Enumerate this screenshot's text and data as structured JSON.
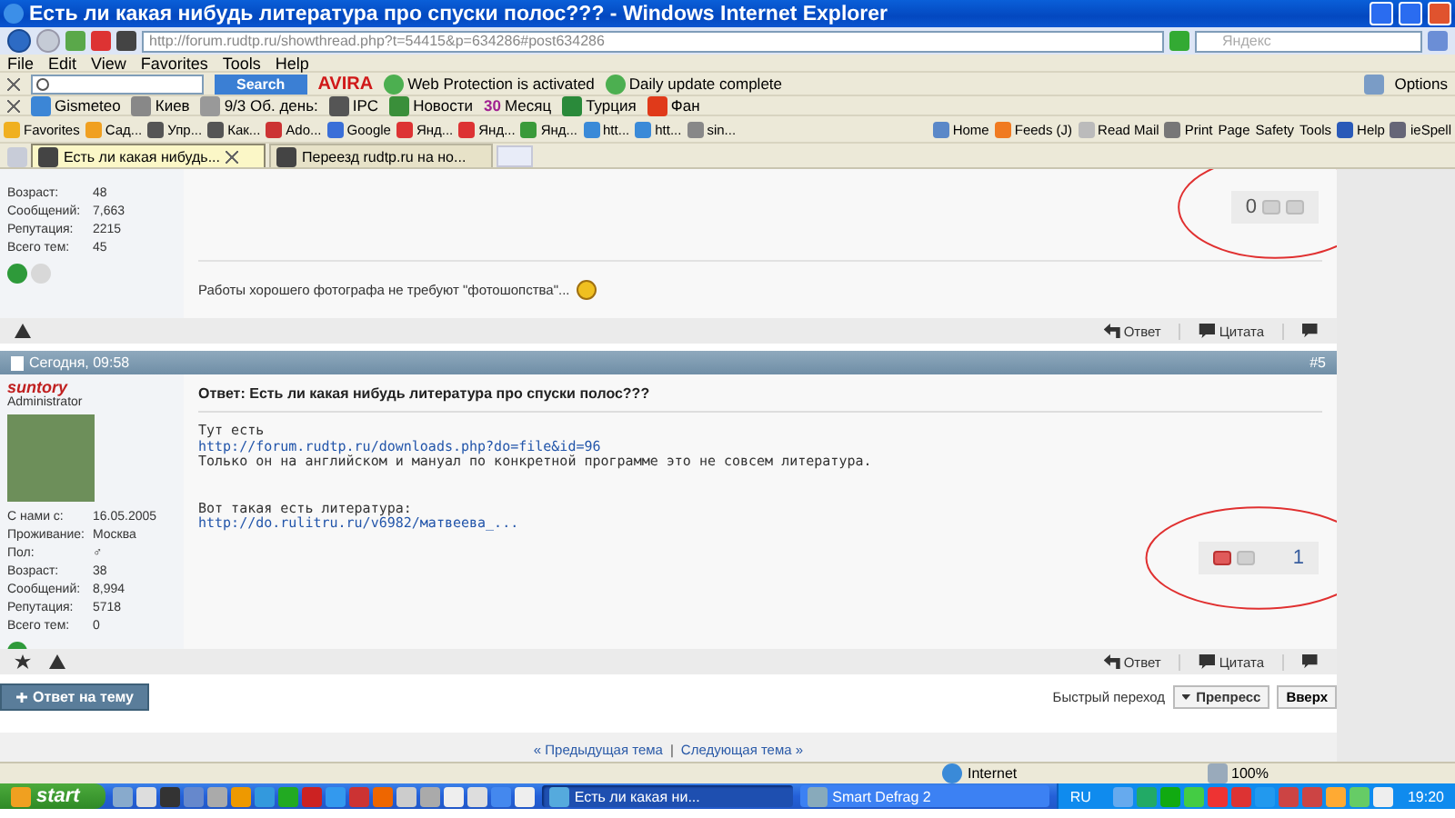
{
  "window": {
    "title": "Есть ли какая нибудь литература про спуски полос??? - Windows Internet Explorer"
  },
  "address_bar": {
    "url": "http://forum.rudtp.ru/showthread.php?t=54415&p=634286#post634286",
    "search_placeholder": "Яндекс"
  },
  "menu": [
    "File",
    "Edit",
    "View",
    "Favorites",
    "Tools",
    "Help"
  ],
  "avira_toolbar": {
    "search_button": "Search",
    "brand": "AVIRA",
    "statuses": [
      "Web Protection is activated",
      "Daily update complete"
    ],
    "options": "Options"
  },
  "weather_toolbar": {
    "items": [
      {
        "label": "Gismeteo"
      },
      {
        "label": "Киев"
      },
      {
        "label": "9/3 Об. день:"
      },
      {
        "label": "IPC"
      },
      {
        "label": "Новости"
      },
      {
        "badge": "30",
        "label": "Месяц"
      },
      {
        "label": "Турция"
      },
      {
        "label": "Фан"
      }
    ]
  },
  "favorites_bar": {
    "label": "Favorites",
    "links": [
      "Сад...",
      "Упр...",
      "Как...",
      "Ado...",
      "Google",
      "Янд...",
      "Янд...",
      "Янд...",
      "htt...",
      "htt...",
      "sin..."
    ],
    "commands": [
      "Home",
      "Feeds (J)",
      "Read Mail",
      "Print",
      "Page",
      "Safety",
      "Tools",
      "Help",
      "ieSpell"
    ]
  },
  "tabs": [
    {
      "label": "Есть ли какая нибудь...",
      "selected": true
    },
    {
      "label": "Переезд rudtp.ru на но...",
      "selected": false
    }
  ],
  "previous_post": {
    "stats": [
      {
        "label": "Возраст:",
        "value": "48"
      },
      {
        "label": "Сообщений:",
        "value": "7,663"
      },
      {
        "label": "Репутация:",
        "value": "2215"
      },
      {
        "label": "Всего тем:",
        "value": "45"
      }
    ],
    "votes": {
      "score": "0",
      "voted_down": false,
      "circled": true
    },
    "signature": "Работы хорошего фотографа не требуют \"фотошопства\"...",
    "actions": [
      "Ответ",
      "Цитата"
    ]
  },
  "post": {
    "date": "Сегодня, 09:58",
    "number": "#5",
    "username": "suntory",
    "rank": "Administrator",
    "stats": [
      {
        "label": "С нами с:",
        "value": "16.05.2005"
      },
      {
        "label": "Проживание:",
        "value": "Москва"
      },
      {
        "label": "Пол:",
        "value": "♂"
      },
      {
        "label": "Возраст:",
        "value": "38"
      },
      {
        "label": "Сообщений:",
        "value": "8,994"
      },
      {
        "label": "Репутация:",
        "value": "5718"
      },
      {
        "label": "Всего тем:",
        "value": "0"
      }
    ],
    "title": "Ответ: Есть ли какая нибудь литература про спуски полос???",
    "body": [
      {
        "kind": "text",
        "text": "Тут есть"
      },
      {
        "kind": "link",
        "text": "http://forum.rudtp.ru/downloads.php?do=file&id=96"
      },
      {
        "kind": "text",
        "text": "Только он на английском и мануал по конкретной программе это не совсем литература."
      },
      {
        "kind": "gap"
      },
      {
        "kind": "text",
        "text": "Вот такая есть литература:"
      },
      {
        "kind": "link",
        "text": "http://do.rulitru.ru/v6982/матвеева_..."
      }
    ],
    "votes": {
      "score": "1",
      "voted_down": true,
      "circled": true
    },
    "actions": [
      "Ответ",
      "Цитата"
    ]
  },
  "footer": {
    "reply_button": "Ответ на тему",
    "quick_nav_label": "Быстрый переход",
    "quick_nav_select": "Препресс",
    "top_button": "Вверх"
  },
  "thread_nav": {
    "previous": "« Предыдущая тема",
    "separator": "|",
    "next": "Следующая тема »"
  },
  "status_bar": {
    "zone": "Internet",
    "zoom": "100%"
  },
  "taskbar": {
    "start": "start",
    "tasks": [
      {
        "label": "Есть ли какая ни...",
        "selected": true
      },
      {
        "label": "Smart Defrag 2",
        "selected": false
      }
    ],
    "language": "RU",
    "clock": "19:20"
  }
}
